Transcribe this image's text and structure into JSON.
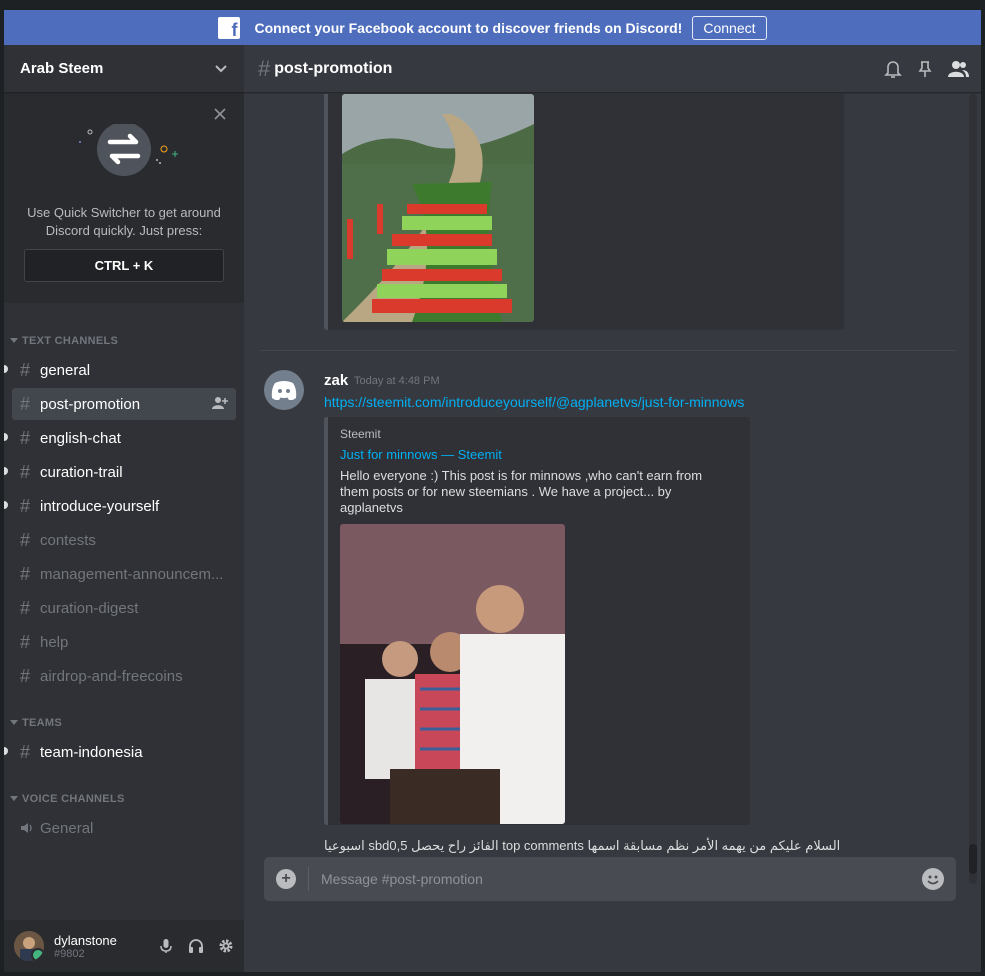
{
  "banner": {
    "text": "Connect your Facebook account to discover friends on Discord!",
    "connect_label": "Connect"
  },
  "guild": {
    "name": "Arab Steem"
  },
  "quick_switcher": {
    "text": "Use Quick Switcher to get around Discord quickly. Just press:",
    "shortcut": "CTRL + K"
  },
  "categories": {
    "text": "TEXT CHANNELS",
    "teams": "TEAMS",
    "voice": "VOICE CHANNELS"
  },
  "text_channels": [
    {
      "name": "general"
    },
    {
      "name": "post-promotion"
    },
    {
      "name": "english-chat"
    },
    {
      "name": "curation-trail"
    },
    {
      "name": "introduce-yourself"
    },
    {
      "name": "contests"
    },
    {
      "name": "management-announcem..."
    },
    {
      "name": "curation-digest"
    },
    {
      "name": "help"
    },
    {
      "name": "airdrop-and-freecoins"
    }
  ],
  "team_channels": [
    {
      "name": "team-indonesia"
    }
  ],
  "voice_channels": [
    {
      "name": "General"
    }
  ],
  "user": {
    "name": "dylanstone",
    "discriminator": "#9802"
  },
  "channel": {
    "name": "post-promotion"
  },
  "message": {
    "author": "zak",
    "timestamp": "Today at 4:48 PM",
    "link": "https://steemit.com/introduceyourself/@agplanetvs/just-for-minnows",
    "embed": {
      "provider": "Steemit",
      "title": "Just for minnows — Steemit",
      "description": "Hello everyone :)  This post is for minnows  ,who can't earn from them posts or for new steemians .  We have a project... by agplanetvs"
    },
    "text": "اسبوعيا sbdالفائز راح يحصل 0,5 top comments السلام عليكم من يهمه الأمر نظم مسابقة اسمها"
  },
  "composer": {
    "placeholder": "Message #post-promotion"
  },
  "colors": {
    "blurple": "#7289da",
    "link": "#00b0f4",
    "facebook": "#4e6ebd",
    "online": "#43b581"
  }
}
